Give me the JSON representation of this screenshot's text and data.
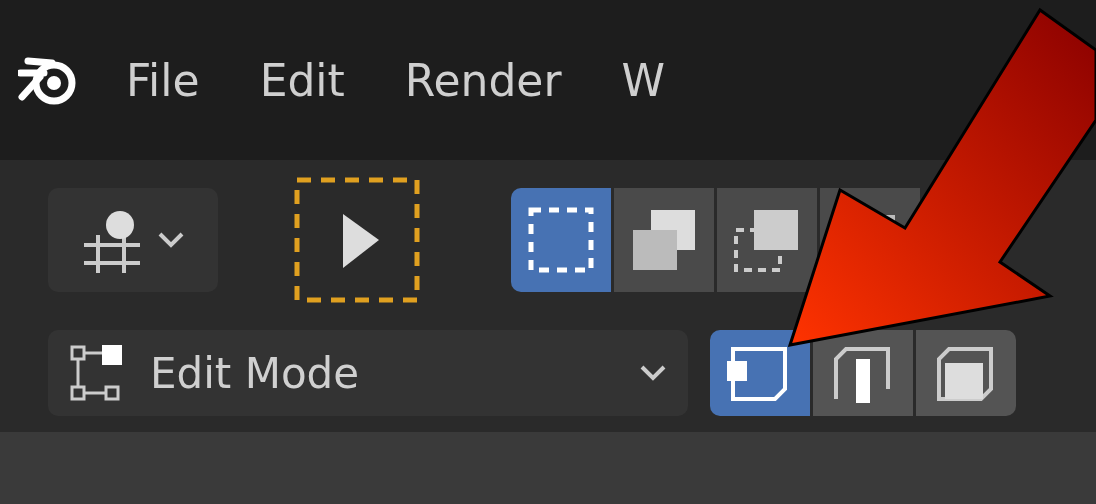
{
  "menu": [
    {
      "label": "File"
    },
    {
      "label": "Edit"
    },
    {
      "label": "Render"
    },
    {
      "label": "W"
    }
  ],
  "toolbar": {
    "select_modes": [
      {
        "selected": true
      },
      {
        "selected": false
      },
      {
        "selected": false
      },
      {
        "selected": false
      }
    ]
  },
  "mode_dropdown": {
    "value": "Edit Mode"
  },
  "mesh_select": [
    {
      "kind": "vertex",
      "selected": true
    },
    {
      "kind": "edge",
      "selected": false
    },
    {
      "kind": "face",
      "selected": false
    }
  ]
}
